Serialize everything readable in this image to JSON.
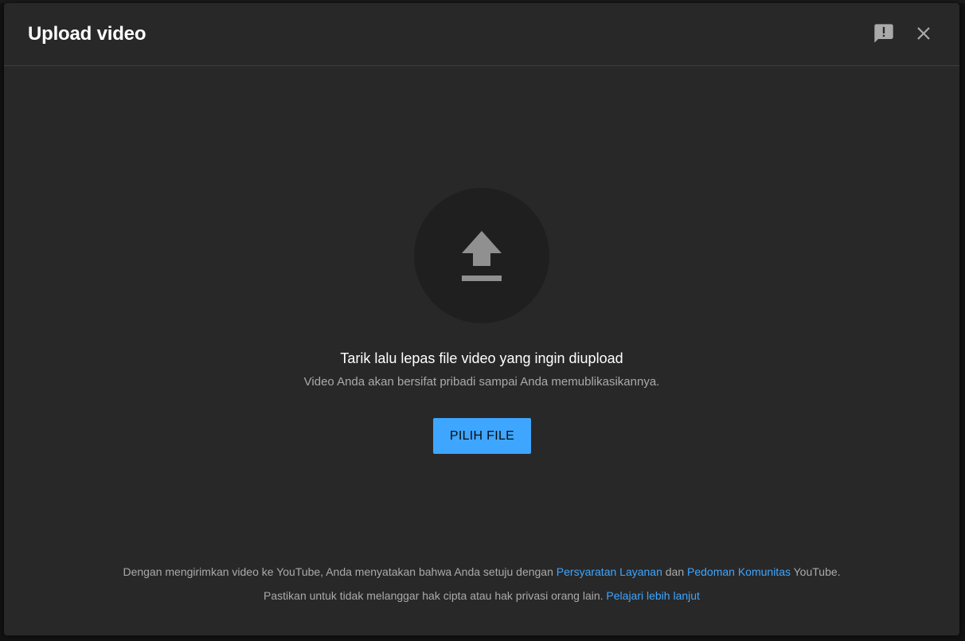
{
  "dialog": {
    "title": "Upload video",
    "feedback_icon": "feedback-icon",
    "close_icon": "close-icon"
  },
  "upload": {
    "icon": "upload-icon",
    "main_text": "Tarik lalu lepas file video yang ingin diupload",
    "sub_text": "Video Anda akan bersifat pribadi sampai Anda memublikasikannya.",
    "button_label": "PILIH FILE"
  },
  "footer": {
    "line1_prefix": "Dengan mengirimkan video ke YouTube, Anda menyatakan bahwa Anda setuju dengan ",
    "terms_link": "Persyaratan Layanan",
    "line1_and": " dan ",
    "guidelines_link": "Pedoman Komunitas",
    "line1_suffix": " YouTube.",
    "line2_prefix": "Pastikan untuk tidak melanggar hak cipta atau hak privasi orang lain. ",
    "learn_more_link": "Pelajari lebih lanjut"
  },
  "colors": {
    "dialog_bg": "#282828",
    "accent": "#3ea6ff",
    "text_primary": "#ffffff",
    "text_secondary": "#aaaaaa"
  }
}
